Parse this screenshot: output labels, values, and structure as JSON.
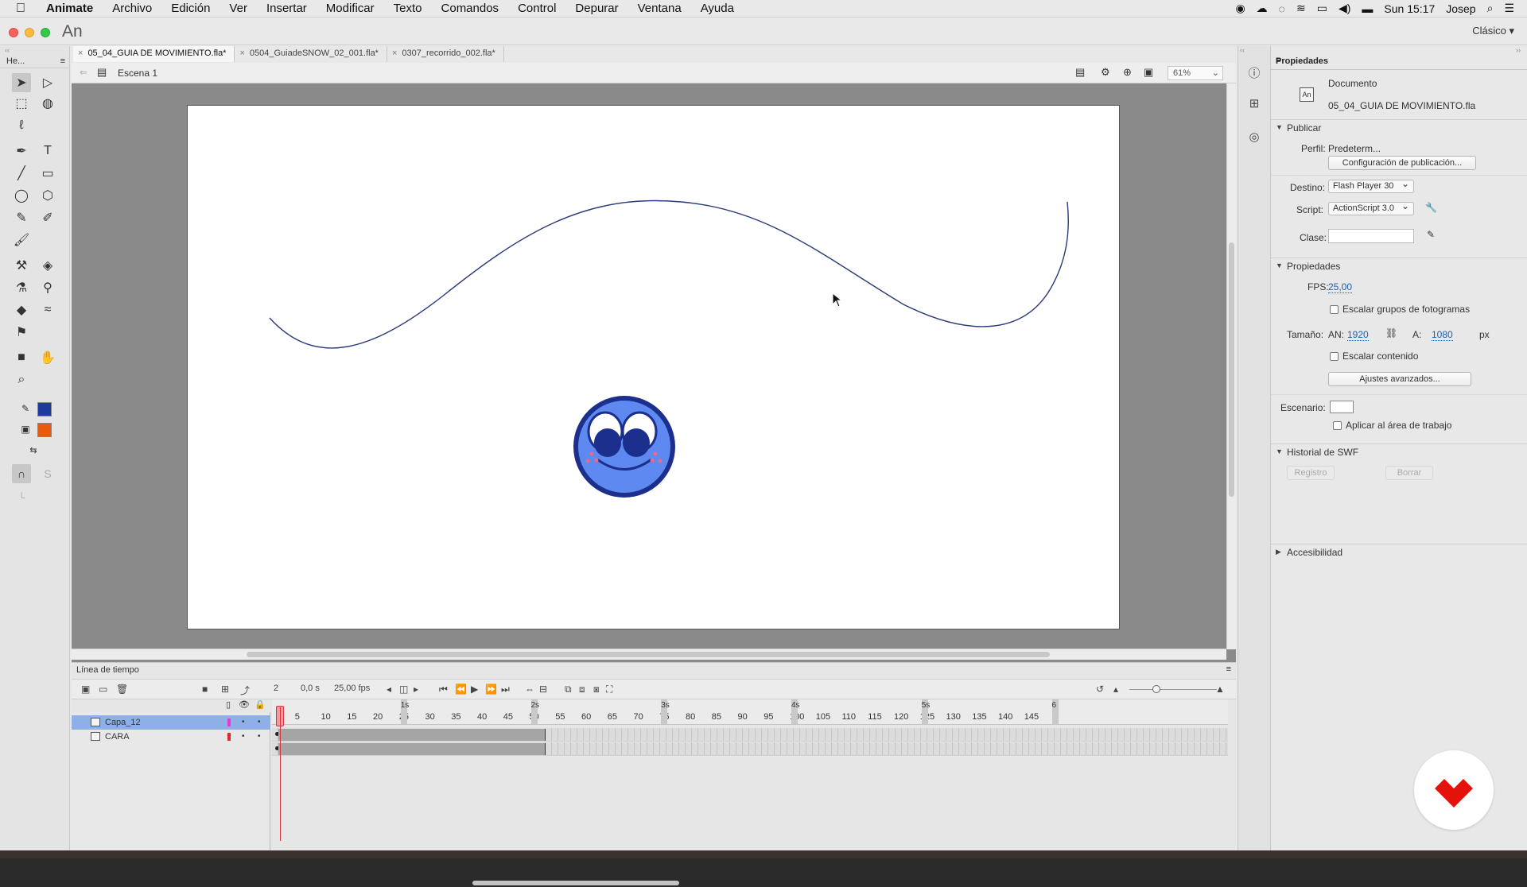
{
  "menubar": {
    "app_name": "Animate",
    "items": [
      "Archivo",
      "Edición",
      "Ver",
      "Insertar",
      "Modificar",
      "Texto",
      "Comandos",
      "Control",
      "Depurar",
      "Ventana",
      "Ayuda"
    ],
    "clock": "Sun 15:17",
    "user": "Josep"
  },
  "titlebar": {
    "logo": "An",
    "workspace": "Clásico"
  },
  "tabs": [
    "05_04_GUIA DE MOVIMIENTO.fla*",
    "0504_GuiadeSNOW_02_001.fla*",
    "0307_recorrido_002.fla*"
  ],
  "tools": {
    "panel_title": "He..."
  },
  "editbar": {
    "scene": "Escena 1",
    "zoom": "61%"
  },
  "colors": {
    "stroke": "#1f3a9a",
    "fill": "#e85b0d",
    "stage_bg": "#ffffff",
    "accent_layer_blue": "#8eb0e6",
    "playhead": "#d8323c"
  },
  "timeline": {
    "title": "Línea de tiempo",
    "current_frame": "2",
    "elapsed": "0,0 s",
    "fps": "25,00 fps",
    "frame_labels": [
      "5",
      "10",
      "15",
      "20",
      "25",
      "30",
      "35",
      "40",
      "45",
      "50",
      "55",
      "60",
      "65",
      "70",
      "75",
      "80",
      "85",
      "90",
      "95",
      "100",
      "105",
      "110",
      "115",
      "120",
      "125",
      "130",
      "135",
      "140",
      "145"
    ],
    "second_labels": [
      "1s",
      "2s",
      "3s",
      "4s",
      "5s",
      "6"
    ],
    "layers": [
      {
        "name": "Capa_12",
        "color": "#e33cd6",
        "selected": true
      },
      {
        "name": "CARA",
        "color": "#e3262e",
        "selected": false
      }
    ]
  },
  "props": {
    "tab": "Propiedades",
    "doc_label": "Documento",
    "doc_name": "05_04_GUIA DE MOVIMIENTO.fla",
    "publish_section": "Publicar",
    "profile_label": "Perfil:",
    "profile_value": "Predeterm...",
    "publish_settings_btn": "Configuración de publicación...",
    "target_label": "Destino:",
    "target_value": "Flash Player 30",
    "script_label": "Script:",
    "script_value": "ActionScript 3.0",
    "class_label": "Clase:",
    "properties_section": "Propiedades",
    "fps_label": "FPS:",
    "fps_value": "25,00",
    "scale_frames_label": "Escalar grupos de fotogramas",
    "size_label": "Tamaño:",
    "width_label": "AN:",
    "width_value": "1920",
    "height_label": "A:",
    "height_value": "1080",
    "unit": "px",
    "scale_content_label": "Escalar contenido",
    "advanced_btn": "Ajustes avanzados...",
    "stage_label": "Escenario:",
    "apply_workarea_label": "Aplicar al área de trabajo",
    "swf_history_section": "Historial de SWF",
    "log_btn": "Registro",
    "clear_btn": "Borrar",
    "accessibility_section": "Accesibilidad"
  }
}
